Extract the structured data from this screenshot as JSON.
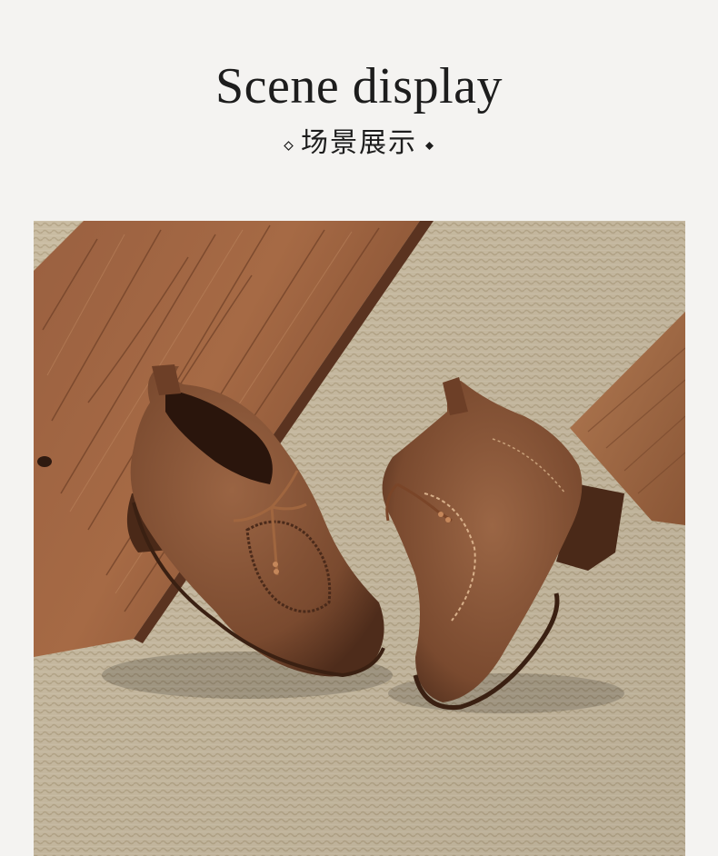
{
  "header": {
    "title_en": "Scene display",
    "title_cn": "场景展示",
    "left_icon": "diamond-outline-icon",
    "right_icon": "diamond-filled-icon"
  },
  "scene": {
    "image_subject": "product-scene-photo",
    "colors": {
      "background": "#f4f3f1",
      "mat": "#d2c3a8",
      "wood": "#8a5638",
      "leather": "#7b4a2f"
    }
  }
}
